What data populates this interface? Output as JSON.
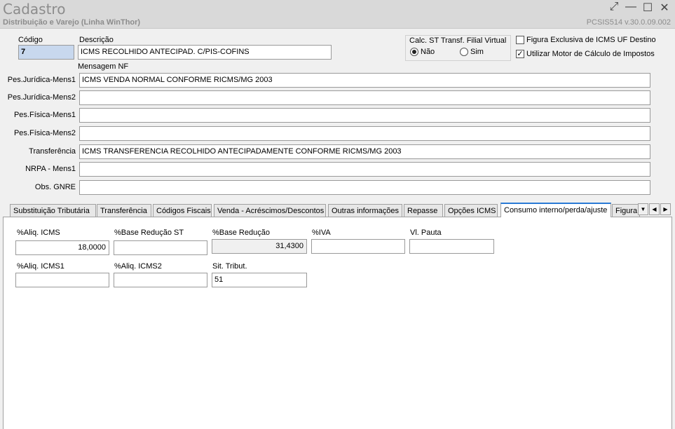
{
  "window": {
    "title": "Cadastro",
    "subtitle": "Distribuição e Varejo (Linha WinThor)",
    "version": "PCSIS514  v.30.0.09.002",
    "controls": {
      "restore": "⤢",
      "minimize": "—",
      "maximize": "☐",
      "close": "✕"
    }
  },
  "header": {
    "codigo_label": "Código",
    "codigo_value": "7",
    "descricao_label": "Descrição",
    "descricao_value": "ICMS RECOLHIDO ANTECIPAD. C/PIS-COFINS",
    "calc_st_label": "Calc. ST Transf. Filial Virtual",
    "radio_nao": "Não",
    "radio_sim": "Sim",
    "radio_selected": "Não",
    "check_figura_label": "Figura Exclusiva de ICMS UF Destino",
    "check_figura_checked": false,
    "check_motor_label": "Utilizar Motor de Cálculo de Impostos",
    "check_motor_checked": true
  },
  "mensagem": {
    "section_label": "Mensagem NF",
    "rows": [
      {
        "label": "Pes.Jurídica-Mens1",
        "value": "ICMS  VENDA NORMAL  CONFORME RICMS/MG 2003"
      },
      {
        "label": "Pes.Jurídica-Mens2",
        "value": ""
      },
      {
        "label": "Pes.Física-Mens1",
        "value": ""
      },
      {
        "label": "Pes.Física-Mens2",
        "value": ""
      },
      {
        "label": "Transferência",
        "value": "ICMS  TRANSFERENCIA  RECOLHIDO ANTECIPADAMENTE CONFORME RICMS/MG 2003"
      },
      {
        "label": "NRPA - Mens1",
        "value": ""
      },
      {
        "label": "Obs. GNRE",
        "value": ""
      }
    ]
  },
  "tabs": [
    "Substituição Tributária",
    "Transferência",
    "Códigos Fiscais",
    "Venda - Acréscimos/Descontos",
    "Outras informações",
    "Repasse",
    "Opções ICMS",
    "Consumo interno/perda/ajuste",
    "Figura"
  ],
  "active_tab": "Consumo interno/perda/ajuste",
  "tab_nav": {
    "down": "▼",
    "left": "◀",
    "right": "▶"
  },
  "consumo": {
    "aliq_icms_label": "%Aliq. ICMS",
    "aliq_icms_value": "18,0000",
    "base_reducao_st_label": "%Base Redução ST",
    "base_reducao_st_value": "",
    "base_reducao_label": "%Base Redução",
    "base_reducao_value": "31,4300",
    "iva_label": "%IVA",
    "iva_value": "",
    "vl_pauta_label": "Vl. Pauta",
    "vl_pauta_value": "",
    "aliq_icms1_label": "%Aliq. ICMS1",
    "aliq_icms1_value": "",
    "aliq_icms2_label": "%Aliq. ICMS2",
    "aliq_icms2_value": "",
    "sit_tribut_label": "Sit. Tribut.",
    "sit_tribut_value": "51"
  },
  "colors": {
    "accent": "#2a7ad5",
    "selected_field": "#c8d8ee",
    "title_text": "#8c8c8c"
  }
}
